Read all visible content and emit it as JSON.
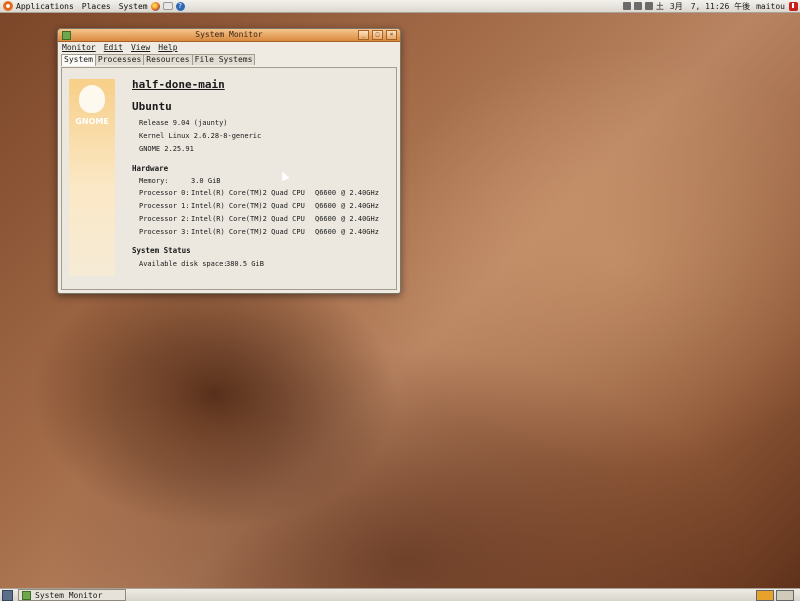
{
  "top_panel": {
    "menus": [
      "Applications",
      "Places",
      "System"
    ],
    "clock": "3月　7, 11:26 午後",
    "day": "土",
    "user": "maitou"
  },
  "window": {
    "title": "System Monitor",
    "buttons": {
      "minimize": "_",
      "maximize": "□",
      "close": "×"
    },
    "menus": [
      "Monitor",
      "Edit",
      "View",
      "Help"
    ],
    "tabs": [
      "System",
      "Processes",
      "Resources",
      "File Systems"
    ],
    "active_tab": "System",
    "banner_text": "GNOME",
    "system": {
      "hostname": "half-done-main",
      "distro": "Ubuntu",
      "release": "Release 9.04 (jaunty)",
      "kernel": "Kernel Linux 2.6.28-8-generic",
      "gnome": "GNOME 2.25.91",
      "hardware_heading": "Hardware",
      "memory_label": "Memory:",
      "memory_value": "3.0 GiB",
      "processors": [
        {
          "label": "Processor 0:",
          "model": "Intel(R) Core(TM)2 Quad CPU",
          "id": "Q6600",
          "speed": "@ 2.40GHz"
        },
        {
          "label": "Processor 1:",
          "model": "Intel(R) Core(TM)2 Quad CPU",
          "id": "Q6600",
          "speed": "@ 2.40GHz"
        },
        {
          "label": "Processor 2:",
          "model": "Intel(R) Core(TM)2 Quad CPU",
          "id": "Q6600",
          "speed": "@ 2.40GHz"
        },
        {
          "label": "Processor 3:",
          "model": "Intel(R) Core(TM)2 Quad CPU",
          "id": "Q6600",
          "speed": "@ 2.40GHz"
        }
      ],
      "status_heading": "System Status",
      "disk_label": "Available disk space:",
      "disk_value": "380.5 GiB"
    }
  },
  "taskbar": {
    "task_label": "System Monitor"
  }
}
